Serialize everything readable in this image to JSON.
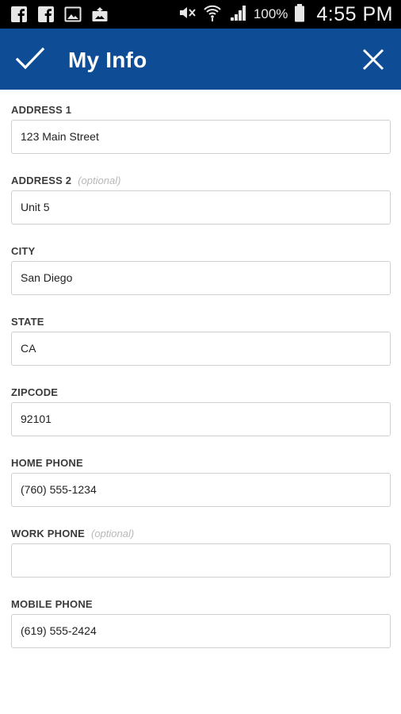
{
  "status_bar": {
    "notification_icons": [
      "facebook-icon",
      "facebook-icon",
      "gallery-icon",
      "photo-upload-icon"
    ],
    "status_icons": [
      "mute-icon",
      "wifi-icon",
      "cell-signal-icon"
    ],
    "battery_percent": "100%",
    "time": "4:55 PM"
  },
  "app_bar": {
    "title": "My Info",
    "background_color": "#0e4d96",
    "confirm_icon": "checkmark-icon",
    "close_icon": "close-icon"
  },
  "form": {
    "address1": {
      "label": "ADDRESS 1",
      "value": "123 Main Street"
    },
    "address2": {
      "label": "ADDRESS 2",
      "optional": "(optional)",
      "value": "Unit 5"
    },
    "city": {
      "label": "CITY",
      "value": "San Diego"
    },
    "state": {
      "label": "STATE",
      "value": "CA"
    },
    "zipcode": {
      "label": "ZIPCODE",
      "value": "92101"
    },
    "home_phone": {
      "label": "HOME PHONE",
      "value": "(760) 555-1234"
    },
    "work_phone": {
      "label": "WORK PHONE",
      "optional": "(optional)",
      "value": ""
    },
    "mobile_phone": {
      "label": "MOBILE PHONE",
      "value": "(619) 555-2424"
    }
  }
}
